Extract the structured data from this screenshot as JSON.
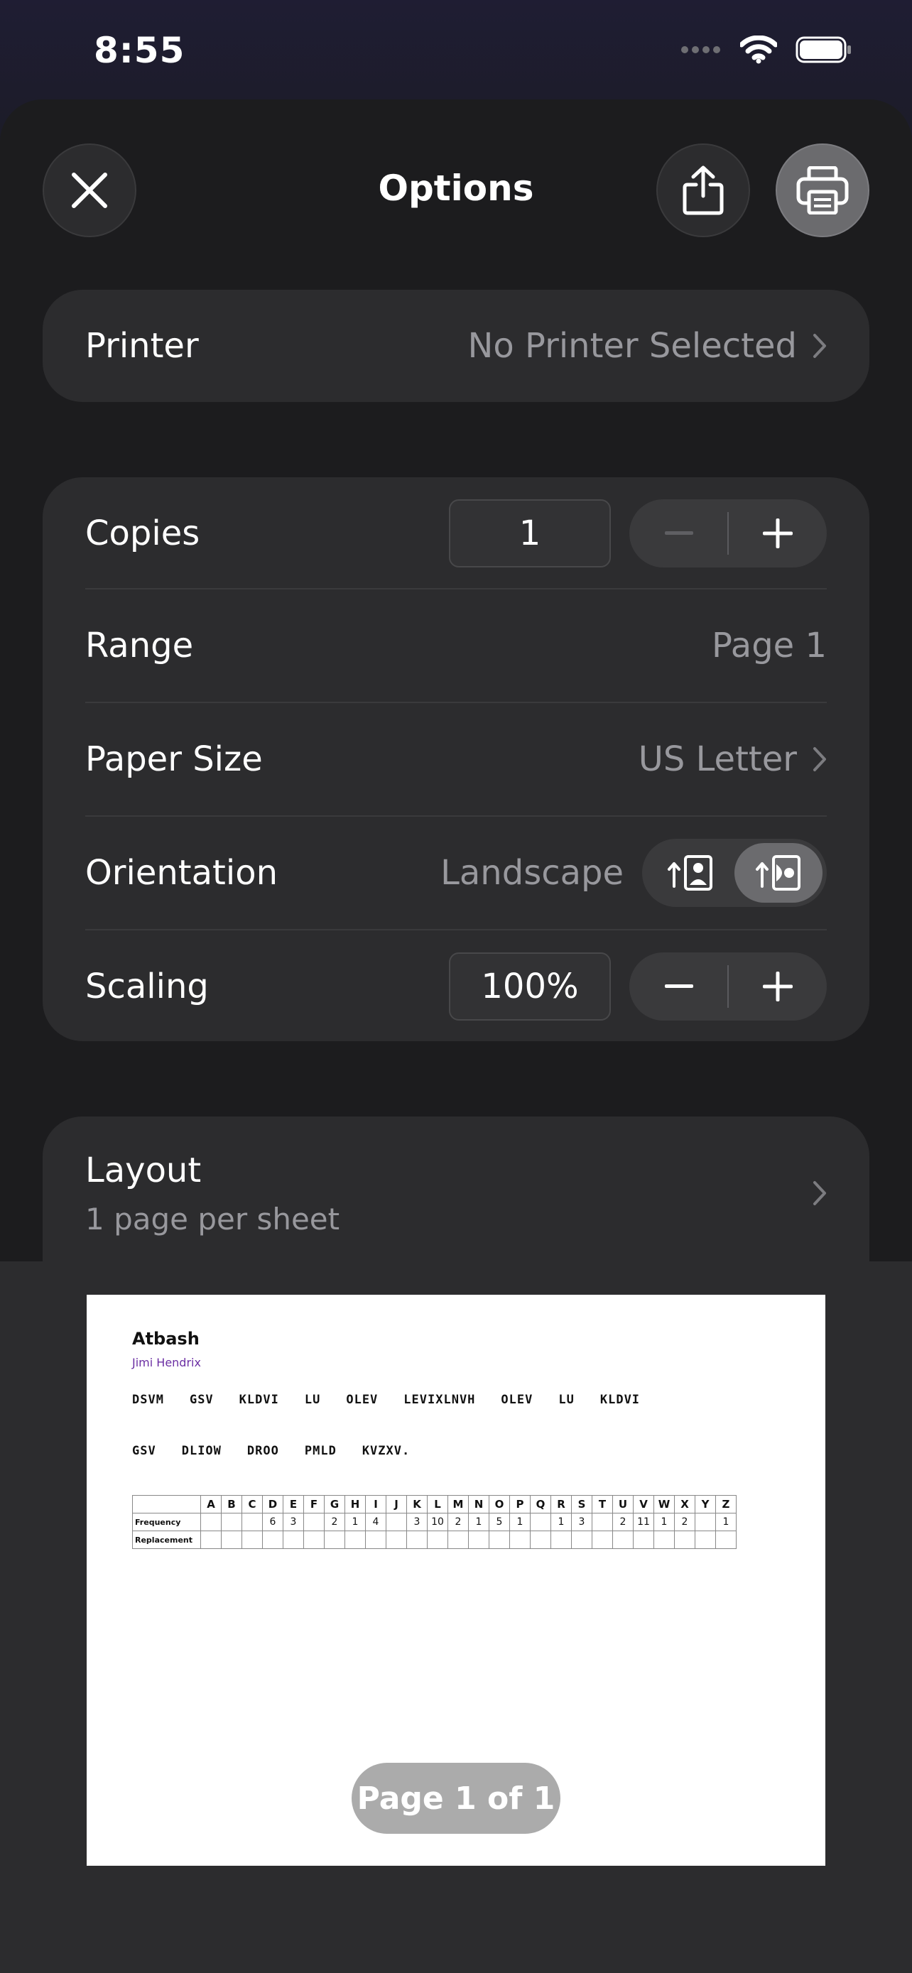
{
  "status_bar": {
    "time": "8:55"
  },
  "header": {
    "title": "Options"
  },
  "printer": {
    "label": "Printer",
    "value": "No Printer Selected"
  },
  "copies": {
    "label": "Copies",
    "value": "1"
  },
  "range": {
    "label": "Range",
    "value": "Page 1"
  },
  "paper_size": {
    "label": "Paper Size",
    "value": "US Letter"
  },
  "orientation": {
    "label": "Orientation",
    "value": "Landscape",
    "selected": "landscape"
  },
  "scaling": {
    "label": "Scaling",
    "value": "100%"
  },
  "layout": {
    "label": "Layout",
    "value": "1 page per sheet"
  },
  "preview": {
    "title": "Atbash",
    "author": "Jimi Hendrix",
    "line1": [
      "DSVM",
      "GSV",
      "KLDVI",
      "LU",
      "OLEV",
      "LEVIXLNVH",
      "OLEV",
      "LU",
      "KLDVI"
    ],
    "line2": [
      "GSV",
      "DLIOW",
      "DROO",
      "PMLD",
      "KVZXV."
    ],
    "table": {
      "letters": [
        "A",
        "B",
        "C",
        "D",
        "E",
        "F",
        "G",
        "H",
        "I",
        "J",
        "K",
        "L",
        "M",
        "N",
        "O",
        "P",
        "Q",
        "R",
        "S",
        "T",
        "U",
        "V",
        "W",
        "X",
        "Y",
        "Z"
      ],
      "frequency_label": "Frequency",
      "replacement_label": "Replacement",
      "frequency": [
        "",
        "",
        "",
        "6",
        "3",
        "",
        "2",
        "1",
        "4",
        "",
        "3",
        "10",
        "2",
        "1",
        "5",
        "1",
        "",
        "1",
        "3",
        "",
        "2",
        "11",
        "1",
        "2",
        "",
        "1"
      ]
    },
    "page_indicator": "Page 1 of 1"
  }
}
